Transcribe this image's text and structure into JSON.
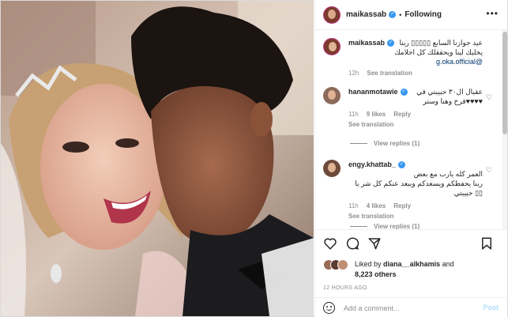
{
  "header": {
    "username": "maikassab",
    "follow_state": "Following",
    "more": "•••",
    "dot": "•"
  },
  "caption": {
    "username": "maikassab",
    "text_ar": "عيد جوازنا السابع ▯▯▯▯▯ ربنا",
    "text_ar2": "يخليك لينا ويحققلك كل احلامك",
    "mention": "@g.oka.official",
    "time": "12h",
    "see_translation": "See translation"
  },
  "comments": [
    {
      "username": "hananmotawie",
      "text_ar": "عقبال ال٣٠ حبيبتي في",
      "text_ar2": "♥♥♥♥فرح وهنا وستر",
      "time": "11h",
      "likes": "9 likes",
      "reply": "Reply",
      "see_translation": "See translation",
      "view_replies": "View replies (1)"
    },
    {
      "username": "engy.khattab_",
      "text_ar": "العمر كله يارب مع بعض",
      "text_ar2": "ربنا يحفظكم ويسعدكم ويبعد عنكم كل شر يا",
      "text_ar3": "▯▯ حبيبتي",
      "time": "11h",
      "likes": "4 likes",
      "reply": "Reply",
      "see_translation": "See translation",
      "view_replies": "View replies (1)"
    }
  ],
  "likes": {
    "prefix": "Liked by",
    "user": "diana__alkhamis",
    "and": "and",
    "others": "8,223 others"
  },
  "time_ago": "12 HOURS AGO",
  "comment_box": {
    "placeholder": "Add a comment...",
    "post": "Post"
  },
  "icons": {
    "like": "heart-icon",
    "comment": "comment-icon",
    "share": "share-icon",
    "save": "bookmark-icon",
    "emoji": "emoji-icon"
  },
  "colors": {
    "verified": "#3897f0",
    "link": "#00376b",
    "muted": "#8e8e8e",
    "post_disabled": "#b2dffc"
  }
}
